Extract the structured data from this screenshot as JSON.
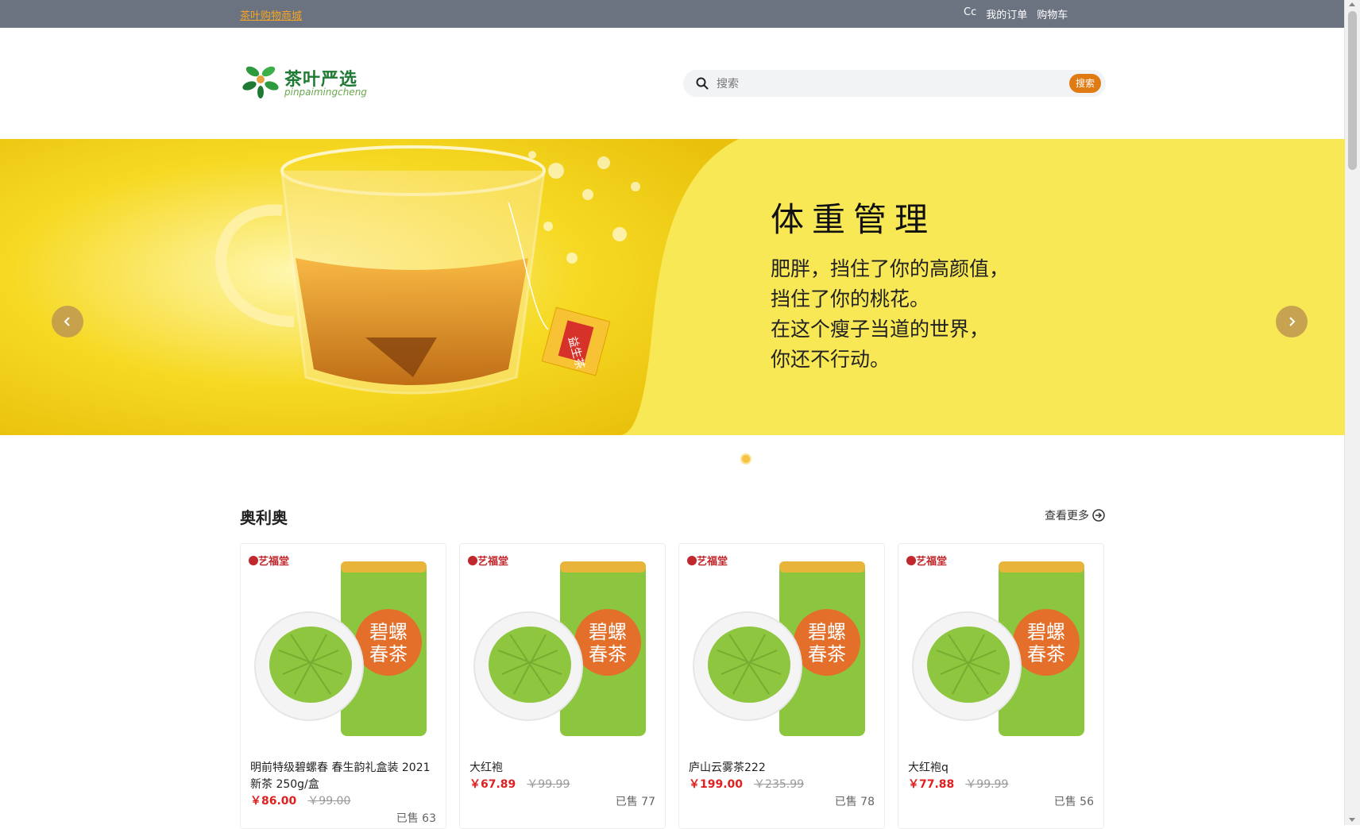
{
  "topbar": {
    "site_name": "茶叶购物商城",
    "user": "Cc",
    "orders": "我的订单",
    "cart": "购物车"
  },
  "header": {
    "logo_text": "茶叶严选",
    "logo_sub": "pinpaimingcheng",
    "search_placeholder": "搜索",
    "search_button": "搜索"
  },
  "banner": {
    "title": "体重管理",
    "lines": [
      "肥胖，挡住了你的高颜值，",
      "挡住了你的桃花。",
      "在这个瘦子当道的世界，",
      "你还不行动。"
    ],
    "tea_tag": "益生茶"
  },
  "section": {
    "title": "奥利奥",
    "more": "查看更多"
  },
  "products": [
    {
      "name": "明前特级碧螺春 春生韵礼盒装 2021新茶 250g/盒",
      "price": "￥86.00",
      "old_price": "￥99.00",
      "sold": "已售 63"
    },
    {
      "name": "大红袍",
      "price": "￥67.89",
      "old_price": "￥99.99",
      "sold": "已售 77"
    },
    {
      "name": "庐山云雾茶222",
      "price": "￥199.00",
      "old_price": "￥235.99",
      "sold": "已售 78"
    },
    {
      "name": "大红袍q",
      "price": "￥77.88",
      "old_price": "￥99.99",
      "sold": "已售 56"
    }
  ],
  "product_image": {
    "brand": "艺福堂",
    "can_text": [
      "碧螺",
      "春茶"
    ]
  },
  "colors": {
    "topbar": "#6b7280",
    "accent": "#e07b14",
    "banner": "#f9e856",
    "price": "#e02020"
  }
}
